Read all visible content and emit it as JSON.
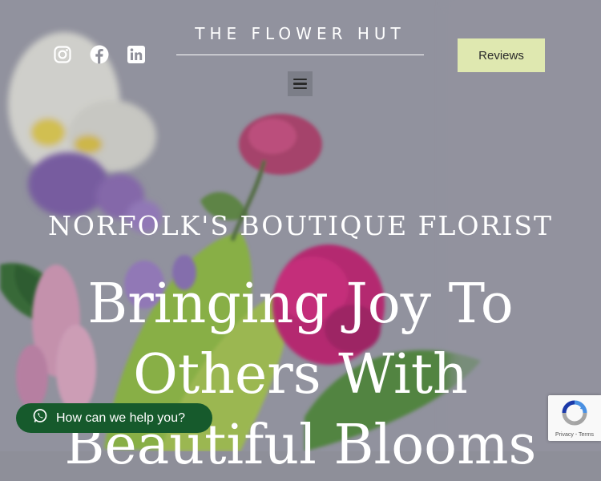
{
  "header": {
    "brand": "THE FLOWER HUT",
    "reviews_label": "Reviews",
    "social": [
      "instagram-icon",
      "facebook-icon",
      "linkedin-icon"
    ],
    "menu_icon": "hamburger-menu-icon"
  },
  "hero": {
    "eyebrow": "NORFOLK'S BOUTIQUE FLORIST",
    "headline_line1": "Bringing Joy To",
    "headline_line2": "Others With",
    "headline_line3": "Beautiful Blooms"
  },
  "chat": {
    "label": "How can we help you?"
  },
  "recaptcha": {
    "links": "Privacy - Terms"
  },
  "colors": {
    "reviews_bg": "#dfe8b0",
    "chat_bg": "#165a2c",
    "text_light": "#ffffff"
  }
}
